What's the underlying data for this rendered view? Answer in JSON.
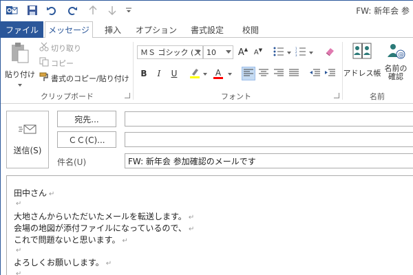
{
  "window": {
    "title": "FW: 新年会 参"
  },
  "qat": {
    "icons": [
      "save-icon",
      "undo-icon",
      "redo-icon",
      "up-arrow-icon",
      "down-arrow-icon",
      "customize-qat-icon"
    ]
  },
  "tabs": [
    {
      "label": "ファイル"
    },
    {
      "label": "メッセージ"
    },
    {
      "label": "挿入"
    },
    {
      "label": "オプション"
    },
    {
      "label": "書式設定"
    },
    {
      "label": "校閲"
    }
  ],
  "ribbon": {
    "clipboard": {
      "paste_label": "貼り付け",
      "cut_label": "切り取り",
      "copy_label": "コピー",
      "format_painter_label": "書式のコピー/貼り付け",
      "group_label": "クリップボード"
    },
    "font": {
      "font_name": "ＭＳ ゴシック (ス",
      "font_size": "10",
      "grow_label": "A",
      "shrink_label": "A",
      "bold_label": "B",
      "italic_label": "I",
      "underline_label": "U",
      "font_color_label": "A",
      "highlight_color": "#ffff00",
      "font_color": "#ff0000",
      "group_label": "フォント"
    },
    "names": {
      "address_book_label": "アドレス帳",
      "check_names_label_1": "名前の",
      "check_names_label_2": "確認",
      "group_label": "名前"
    }
  },
  "compose": {
    "send_label": "送信(S)",
    "to_button": "宛先...",
    "cc_button": "ＣＣ(C)...",
    "subject_label": "件名(U)",
    "to_value": "",
    "cc_value": "",
    "subject_value": "FW: 新年会 参加確認のメールです"
  },
  "body": {
    "lines": [
      "田中さん",
      "",
      "大地さんからいただいたメールを転送します。",
      "会場の地図が添付ファイルになっているので、",
      "これで問題ないと思います。",
      "",
      "よろしくお願いします。",
      ""
    ],
    "paragraph_mark": "↵"
  },
  "colors": {
    "accent": "#2b579a",
    "pressed_bg": "#c5dbf3"
  }
}
